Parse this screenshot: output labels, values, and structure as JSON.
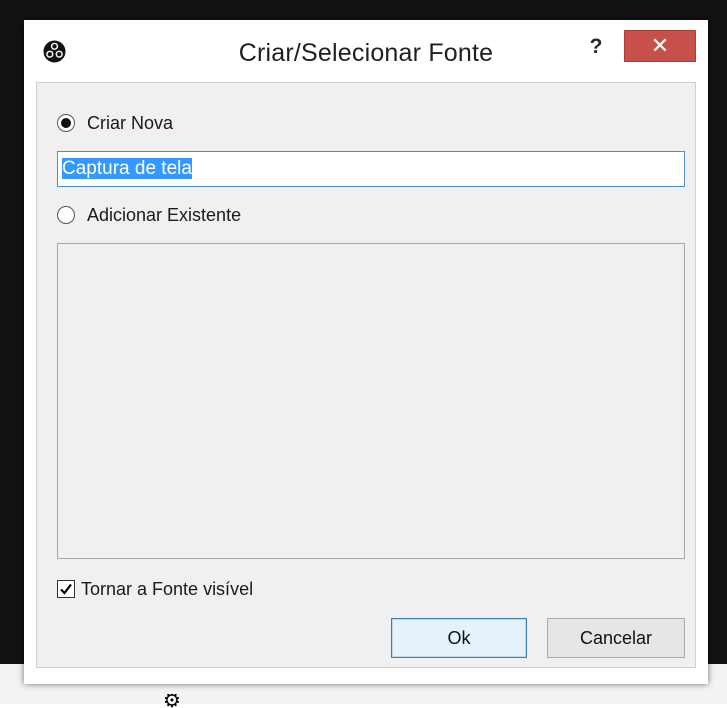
{
  "dialog": {
    "title": "Criar/Selecionar Fonte",
    "help_label": "?",
    "close_label": "✕"
  },
  "options": {
    "create_new_label": "Criar Nova",
    "create_new_selected": true,
    "name_value": "Captura de tela",
    "add_existing_label": "Adicionar Existente",
    "add_existing_selected": false,
    "existing_sources": []
  },
  "visible_checkbox": {
    "label": "Tornar a Fonte visível",
    "checked": true
  },
  "buttons": {
    "ok_label": "Ok",
    "cancel_label": "Cancelar"
  },
  "colors": {
    "close_button": "#c7504a",
    "selection_highlight": "#3399ff",
    "input_focus_border": "#4a90d0"
  },
  "icons": {
    "app": "obs-logo-icon",
    "background": "gear-icon"
  }
}
